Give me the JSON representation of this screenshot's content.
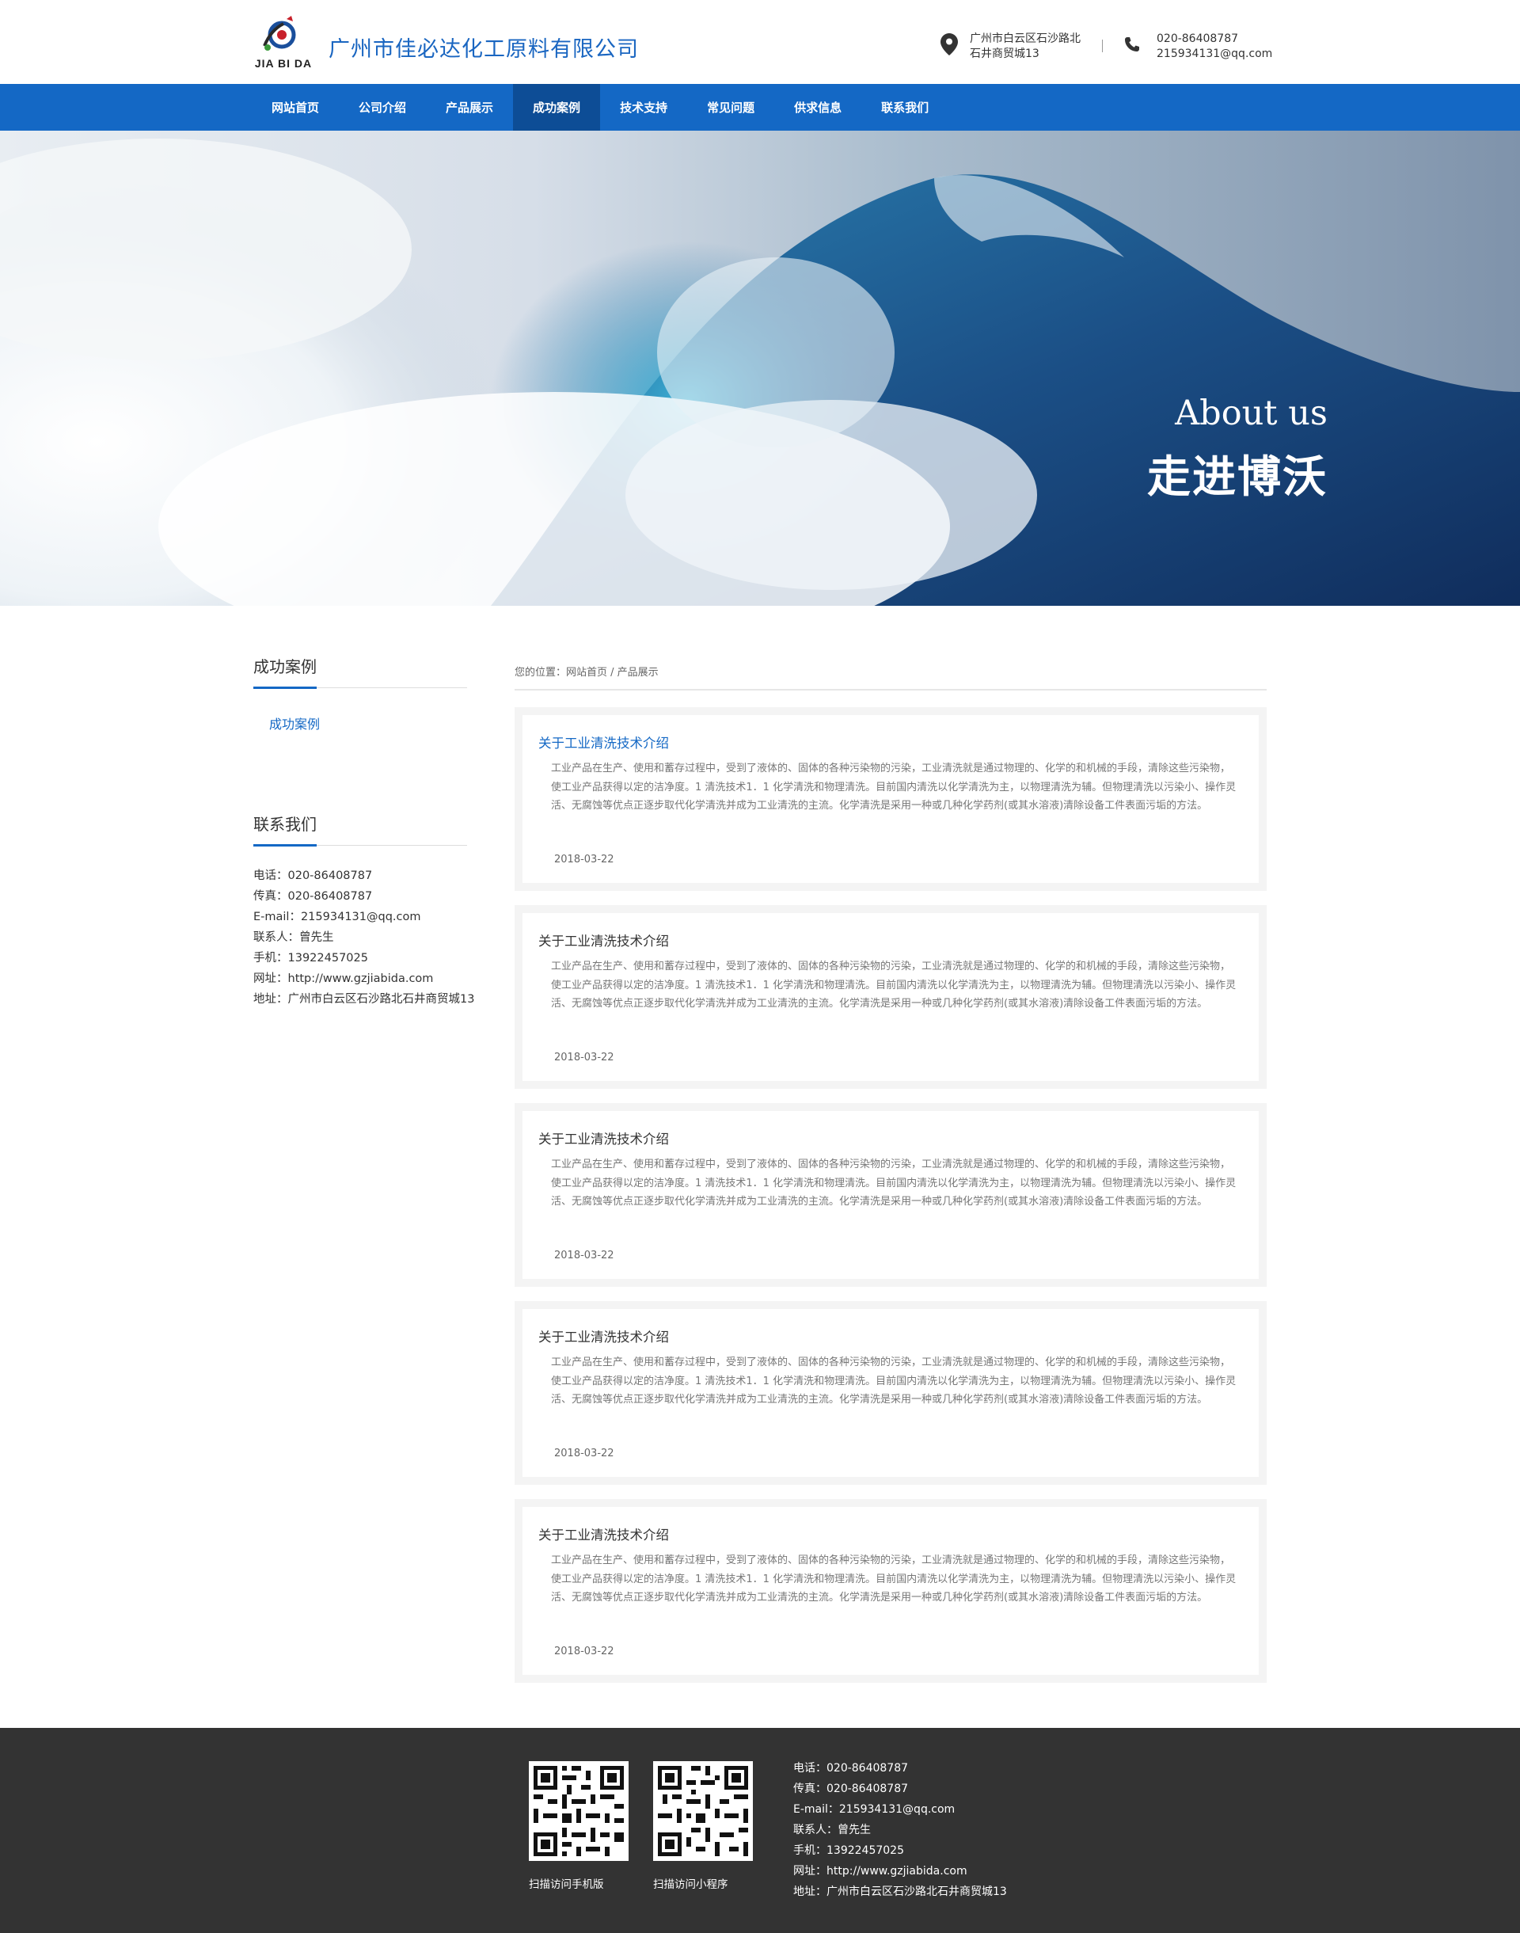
{
  "header": {
    "logo_text": "JIA BI DA",
    "company_name": "广州市佳必达化工原料有限公司",
    "address_line1": "广州市白云区石沙路北",
    "address_line2": "石井商贸城13",
    "phone": "020-86408787",
    "email": "215934131@qq.com"
  },
  "nav": {
    "items": [
      "网站首页",
      "公司介绍",
      "产品展示",
      "成功案例",
      "技术支持",
      "常见问题",
      "供求信息",
      "联系我们"
    ],
    "active_index": 3
  },
  "banner": {
    "title_en": "About us",
    "title_cn": "走进博沃"
  },
  "sidebar": {
    "category_title": "成功案例",
    "category_link": "成功案例",
    "contact_title": "联系我们",
    "contact_lines": [
      "电话：020-86408787",
      "传真：020-86408787",
      "E-mail：215934131@qq.com",
      "联系人：曾先生",
      "手机：13922457025",
      "网址：http://www.gzjiabida.com",
      "地址：广州市白云区石沙路北石井商贸城13"
    ]
  },
  "breadcrumb": "您的位置：网站首页 /  产品展示",
  "articles": [
    {
      "title": "关于工业清洗技术介绍",
      "desc": "工业产品在生产、使用和蓄存过程中，受到了液体的、固体的各种污染物的污染，工业清洗就是通过物理的、化学的和机械的手段，清除这些污染物，使工业产品获得以定的洁净度。1 清洗技术1．1 化学清洗和物理清洗。目前国内清洗以化学清洗为主，以物理清洗为辅。但物理清洗以污染小、操作灵活、无腐蚀等优点正逐步取代化学清洗并成为工业清洗的主流。化学清洗是采用一种或几种化学药剂(或其水溶液)清除设备工件表面污垢的方法。",
      "date": "2018-03-22"
    },
    {
      "title": "关于工业清洗技术介绍",
      "desc": "工业产品在生产、使用和蓄存过程中，受到了液体的、固体的各种污染物的污染，工业清洗就是通过物理的、化学的和机械的手段，清除这些污染物，使工业产品获得以定的洁净度。1 清洗技术1．1 化学清洗和物理清洗。目前国内清洗以化学清洗为主，以物理清洗为辅。但物理清洗以污染小、操作灵活、无腐蚀等优点正逐步取代化学清洗并成为工业清洗的主流。化学清洗是采用一种或几种化学药剂(或其水溶液)清除设备工件表面污垢的方法。",
      "date": "2018-03-22"
    },
    {
      "title": "关于工业清洗技术介绍",
      "desc": "工业产品在生产、使用和蓄存过程中，受到了液体的、固体的各种污染物的污染，工业清洗就是通过物理的、化学的和机械的手段，清除这些污染物，使工业产品获得以定的洁净度。1 清洗技术1．1 化学清洗和物理清洗。目前国内清洗以化学清洗为主，以物理清洗为辅。但物理清洗以污染小、操作灵活、无腐蚀等优点正逐步取代化学清洗并成为工业清洗的主流。化学清洗是采用一种或几种化学药剂(或其水溶液)清除设备工件表面污垢的方法。",
      "date": "2018-03-22"
    },
    {
      "title": "关于工业清洗技术介绍",
      "desc": "工业产品在生产、使用和蓄存过程中，受到了液体的、固体的各种污染物的污染，工业清洗就是通过物理的、化学的和机械的手段，清除这些污染物，使工业产品获得以定的洁净度。1 清洗技术1．1 化学清洗和物理清洗。目前国内清洗以化学清洗为主，以物理清洗为辅。但物理清洗以污染小、操作灵活、无腐蚀等优点正逐步取代化学清洗并成为工业清洗的主流。化学清洗是采用一种或几种化学药剂(或其水溶液)清除设备工件表面污垢的方法。",
      "date": "2018-03-22"
    },
    {
      "title": "关于工业清洗技术介绍",
      "desc": "工业产品在生产、使用和蓄存过程中，受到了液体的、固体的各种污染物的污染，工业清洗就是通过物理的、化学的和机械的手段，清除这些污染物，使工业产品获得以定的洁净度。1 清洗技术1．1 化学清洗和物理清洗。目前国内清洗以化学清洗为主，以物理清洗为辅。但物理清洗以污染小、操作灵活、无腐蚀等优点正逐步取代化学清洗并成为工业清洗的主流。化学清洗是采用一种或几种化学药剂(或其水溶液)清除设备工件表面污垢的方法。",
      "date": "2018-03-22"
    }
  ],
  "footer": {
    "qr1_label": "扫描访问手机版",
    "qr2_label": "扫描访问小程序",
    "contact_lines": [
      "电话：020-86408787",
      "传真：020-86408787",
      "E-mail：215934131@qq.com",
      "联系人：曾先生",
      "手机：13922457025",
      "网址：http://www.gzjiabida.com",
      "地址：广州市白云区石沙路北石井商贸城13"
    ]
  },
  "colors": {
    "brand_blue": "#1468c5",
    "nav_active": "#0d4d96",
    "footer_bg": "#333333"
  },
  "icons": [
    "logo-icon",
    "location-pin-icon",
    "phone-icon",
    "qr-code-icon"
  ]
}
